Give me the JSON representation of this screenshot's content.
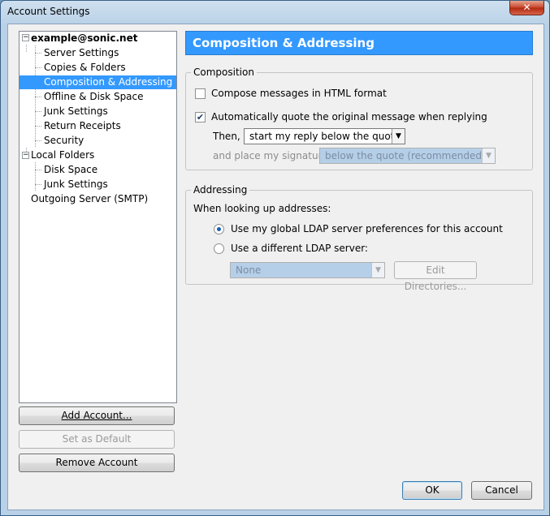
{
  "window": {
    "title": "Account Settings",
    "close_glyph": "✕"
  },
  "tree": {
    "account": "example@sonic.net",
    "account_children": [
      "Server Settings",
      "Copies & Folders",
      "Composition & Addressing",
      "Offline & Disk Space",
      "Junk Settings",
      "Return Receipts",
      "Security"
    ],
    "local": "Local Folders",
    "local_children": [
      "Disk Space",
      "Junk Settings"
    ],
    "smtp": "Outgoing Server (SMTP)",
    "expander_glyph": "−"
  },
  "buttons": {
    "add_account": "Add Account...",
    "set_default": "Set as Default",
    "remove_account": "Remove Account",
    "ok": "OK",
    "cancel": "Cancel"
  },
  "panel": {
    "title": "Composition & Addressing",
    "composition": {
      "legend": "Composition",
      "html_format_label": "Compose messages in HTML format",
      "html_format_checked": false,
      "auto_quote_label": "Automatically quote the original message when replying",
      "auto_quote_checked": true,
      "check_glyph": "✔",
      "then_label": "Then,",
      "reply_position": "start my reply below the quote",
      "signature_label": "and place my signature",
      "signature_position": "below the quote (recommended)"
    },
    "addressing": {
      "legend": "Addressing",
      "lookup_label": "When looking up addresses:",
      "global_ldap_label": "Use my global LDAP server preferences for this account",
      "different_ldap_label": "Use a different LDAP server:",
      "selected_option": "global",
      "ldap_server": "None",
      "edit_directories": "Edit Directories..."
    }
  },
  "colors": {
    "accent": "#3399ff",
    "selection": "#3399ff",
    "titlebar": "#b9d1e7"
  },
  "icons": {
    "dropdown": "▼"
  }
}
